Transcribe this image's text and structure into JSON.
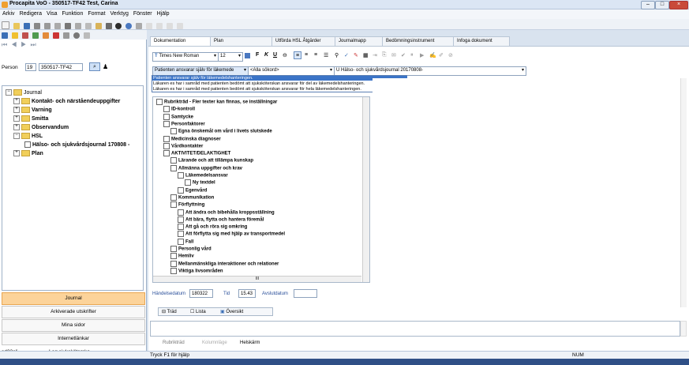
{
  "window": {
    "title": "Procapita VoO - 350517-TF42 Test, Carina"
  },
  "menu": [
    "Arkiv",
    "Redigera",
    "Visa",
    "Funktion",
    "Format",
    "Verktyg",
    "Fönster",
    "Hjälp"
  ],
  "person": {
    "label": "Person",
    "num": "19",
    "id": "350517-TF42"
  },
  "nav_tree": {
    "journal": "Journal",
    "kontakt": "Kontakt- och närståendeuppgifter",
    "varning": "Varning",
    "smitta": "Smitta",
    "observandum": "Observandum",
    "hsl": "HSL",
    "halso": "Hälso- och sjukvårdsjournal 170808 -",
    "plan": "Plan"
  },
  "left_buttons": {
    "journal": "Journal",
    "arkiv": "Arkiverade utskrifter",
    "mina": "Mina sidor",
    "internet": "Internetlänkar"
  },
  "user": {
    "id": "sd23eli",
    "role": "Leg.sjuksköterska"
  },
  "tabs": [
    "Dokumentation",
    "Plan",
    "Utförda HSL Åtgärder",
    "Journalmapp",
    "Bedömningsinstrument",
    "Infoga dokument"
  ],
  "font": {
    "name": "Times New Roman",
    "size": "12"
  },
  "format_buttons": {
    "bold": "F",
    "italic": "K",
    "underline": "U"
  },
  "combos": {
    "responsibility": "Patienten ansvarar själv för läkemede",
    "search": "<Alla sökord>",
    "journal": "U Hälso- och sjukvårdsjournal 20170808-"
  },
  "dropdown_options": [
    "Patienten ansvarar själv för läkemedelshanteringen.",
    "Läkaren es har i samråd med patienten bedömt att sjuksköterskan ansvarar för del av läkemedelshanteringen.",
    "Läkaren es har i samråd med patienten bedömt att sjuksköterskan ansvarar för hela läkemedelshanteringen."
  ],
  "keyword_tree": [
    {
      "label": "Rubrikträd - Fler texter kan finnas, se inställningar",
      "indent": 0
    },
    {
      "label": "ID-kontroll",
      "indent": 1
    },
    {
      "label": "Samtycke",
      "indent": 1
    },
    {
      "label": "Personfaktorer",
      "indent": 1
    },
    {
      "label": "Egna önskemål om vård i livets slutskede",
      "indent": 2
    },
    {
      "label": "Medicinska diagnoser",
      "indent": 1
    },
    {
      "label": "Vårdkontakter",
      "indent": 1
    },
    {
      "label": "AKTIVITET/DELAKTIGHET",
      "indent": 1
    },
    {
      "label": "Lärande och att tillämpa kunskap",
      "indent": 2
    },
    {
      "label": "Allmänna uppgifter och krav",
      "indent": 2
    },
    {
      "label": "Läkemedelsansvar",
      "indent": 3
    },
    {
      "label": "Ny textdel",
      "indent": 4
    },
    {
      "label": "Egenvård",
      "indent": 3
    },
    {
      "label": "Kommunikation",
      "indent": 2
    },
    {
      "label": "Förflyttning",
      "indent": 2
    },
    {
      "label": "Att ändra och bibehålla kroppsställning",
      "indent": 3
    },
    {
      "label": "Att bära, flytta och hantera föremål",
      "indent": 3
    },
    {
      "label": "Att gå och röra sig omkring",
      "indent": 3
    },
    {
      "label": "Att förflytta sig med hjälp av transportmedel",
      "indent": 3
    },
    {
      "label": "Fall",
      "indent": 3
    },
    {
      "label": "Personlig vård",
      "indent": 2
    },
    {
      "label": "Hemliv",
      "indent": 2
    },
    {
      "label": "Mellanmänskliga interaktioner och relationer",
      "indent": 2
    },
    {
      "label": "Viktiga livsområden",
      "indent": 2
    }
  ],
  "event": {
    "date_label": "Händelsedatum",
    "date": "180322",
    "time_label": "Tid",
    "time": "15.43",
    "end_label": "Avslutdatum"
  },
  "view_tabs": [
    "Träd",
    "Lista",
    "Översikt"
  ],
  "bottom_tabs": [
    "Rubrikträd",
    "Kolumnläge",
    "Helskärm"
  ],
  "status": {
    "help": "Tryck F1 för hjälp",
    "num": "NUM"
  },
  "scroll_mid": "III"
}
